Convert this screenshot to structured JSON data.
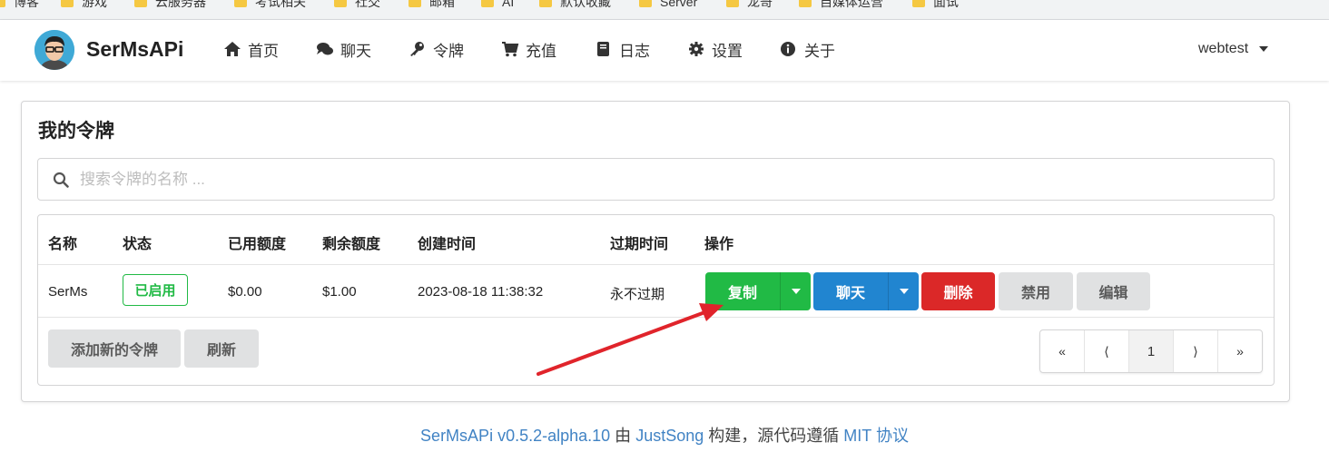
{
  "bookmarks": [
    "博客",
    "游戏",
    "云服务器",
    "考试相关",
    "社交",
    "邮箱",
    "AI",
    "默认收藏",
    "Server",
    "龙哥",
    "自媒体运营",
    "面试"
  ],
  "navbar": {
    "brand": "SerMsAPi",
    "items": [
      {
        "label": "首页",
        "icon": "home-icon"
      },
      {
        "label": "聊天",
        "icon": "chat-icon"
      },
      {
        "label": "令牌",
        "icon": "key-icon"
      },
      {
        "label": "充值",
        "icon": "cart-icon"
      },
      {
        "label": "日志",
        "icon": "book-icon"
      },
      {
        "label": "设置",
        "icon": "gear-icon"
      },
      {
        "label": "关于",
        "icon": "info-icon"
      }
    ],
    "user": "webtest"
  },
  "card": {
    "title": "我的令牌",
    "search_placeholder": "搜索令牌的名称 ...",
    "table": {
      "headers": [
        "名称",
        "状态",
        "已用额度",
        "剩余额度",
        "创建时间",
        "过期时间",
        "操作"
      ],
      "row": {
        "name": "SerMs",
        "status": "已启用",
        "used": "$0.00",
        "remaining": "$1.00",
        "created": "2023-08-18 11:38:32",
        "expires": "永不过期"
      },
      "actions": {
        "copy": "复制",
        "chat": "聊天",
        "delete": "删除",
        "disable": "禁用",
        "edit": "编辑"
      }
    },
    "footer_buttons": {
      "add": "添加新的令牌",
      "refresh": "刷新"
    },
    "pagination": [
      "«",
      "⟨",
      "1",
      "⟩",
      "»"
    ]
  },
  "footer": {
    "app": "SerMsAPi v0.5.2-alpha.10",
    "by": "由",
    "author": "JustSong",
    "built": "构建，源代码遵循",
    "license": "MIT 协议"
  },
  "colors": {
    "green": "#21ba45",
    "blue": "#2185d0",
    "red": "#db2828",
    "link": "#4183c4",
    "annotation_arrow": "#e0242b"
  }
}
